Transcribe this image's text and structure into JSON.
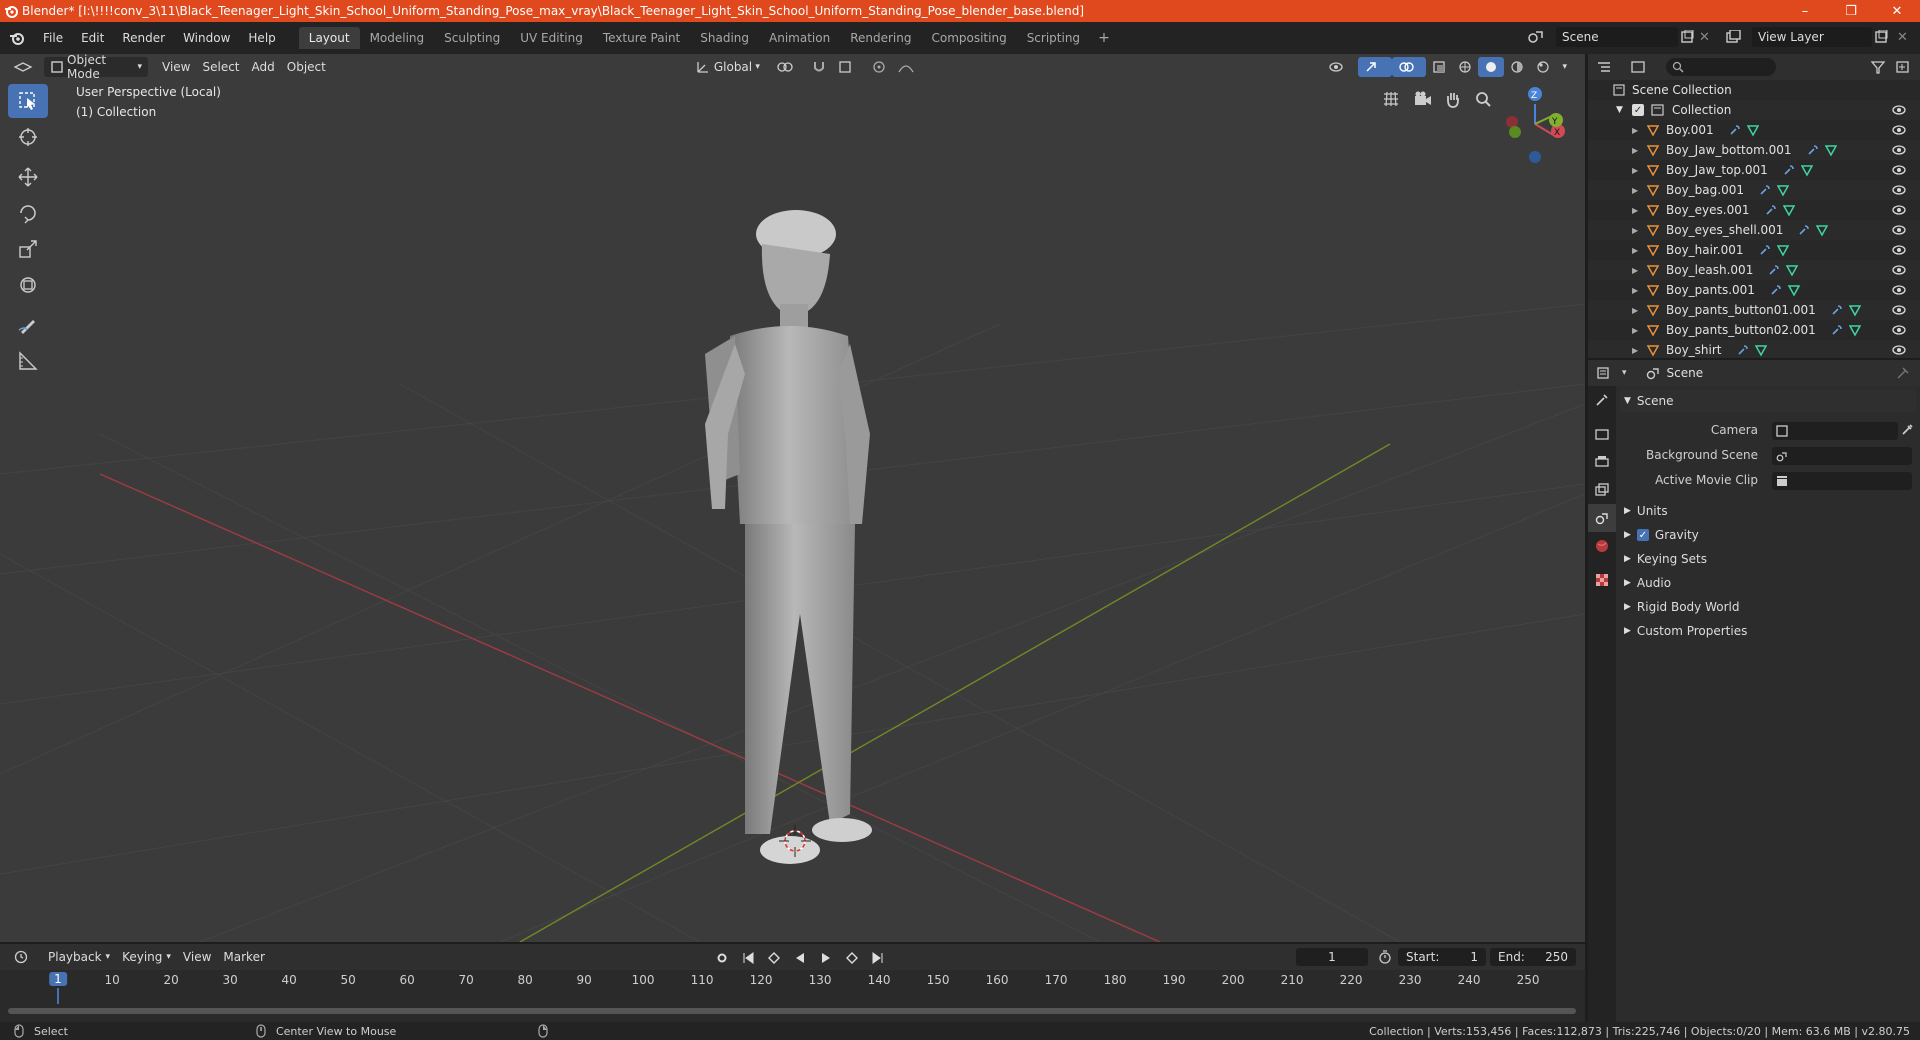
{
  "window": {
    "title": "Blender* [I:\\!!!!conv_3\\11\\Black_Teenager_Light_Skin_School_Uniform_Standing_Pose_max_vray\\Black_Teenager_Light_Skin_School_Uniform_Standing_Pose_blender_base.blend]",
    "minimize": "–",
    "maximize": "❐",
    "close": "✕"
  },
  "menu": [
    "File",
    "Edit",
    "Render",
    "Window",
    "Help"
  ],
  "workspaces": [
    "Layout",
    "Modeling",
    "Sculpting",
    "UV Editing",
    "Texture Paint",
    "Shading",
    "Animation",
    "Rendering",
    "Compositing",
    "Scripting"
  ],
  "workspace_add": "+",
  "scene_name": "Scene",
  "view_layer": "View Layer",
  "viewport": {
    "mode": "Object Mode",
    "menus": [
      "View",
      "Select",
      "Add",
      "Object"
    ],
    "transform_orientation": "Global",
    "overlay_line1": "User Perspective (Local)",
    "overlay_line2": "(1) Collection",
    "axis_z": "Z",
    "axis_y": "Y",
    "axis_x": "X"
  },
  "outliner": {
    "root": "Scene Collection",
    "collection": "Collection",
    "items": [
      "Boy.001",
      "Boy_Jaw_bottom.001",
      "Boy_Jaw_top.001",
      "Boy_bag.001",
      "Boy_eyes.001",
      "Boy_eyes_shell.001",
      "Boy_hair.001",
      "Boy_leash.001",
      "Boy_pants.001",
      "Boy_pants_button01.001",
      "Boy_pants_button02.001",
      "Boy_shirt"
    ]
  },
  "properties": {
    "header": "Scene",
    "section": "Scene",
    "camera_label": "Camera",
    "background_scene_label": "Background Scene",
    "active_movie_clip_label": "Active Movie Clip",
    "panels": [
      "Units",
      "Gravity",
      "Keying Sets",
      "Audio",
      "Rigid Body World",
      "Custom Properties"
    ],
    "gravity_checked": true
  },
  "timeline": {
    "menus": [
      "Playback",
      "Keying",
      "View",
      "Marker"
    ],
    "current_frame": "1",
    "start_label": "Start:",
    "start": "1",
    "end_label": "End:",
    "end": "250",
    "ticks": [
      "1",
      "10",
      "20",
      "30",
      "40",
      "50",
      "60",
      "70",
      "80",
      "90",
      "100",
      "110",
      "120",
      "130",
      "140",
      "150",
      "160",
      "170",
      "180",
      "190",
      "200",
      "210",
      "220",
      "230",
      "240",
      "250"
    ]
  },
  "status": {
    "left": "Select",
    "middle": "Center View to Mouse",
    "right": "Collection | Verts:153,456 | Faces:112,873 | Tris:225,746 | Objects:0/20 | Mem: 63.6 MB | v2.80.75"
  },
  "colors": {
    "title_bar": "#e0481d",
    "accent": "#4772b3",
    "x_axis": "#b5404a",
    "y_axis": "#7a9a2a"
  }
}
